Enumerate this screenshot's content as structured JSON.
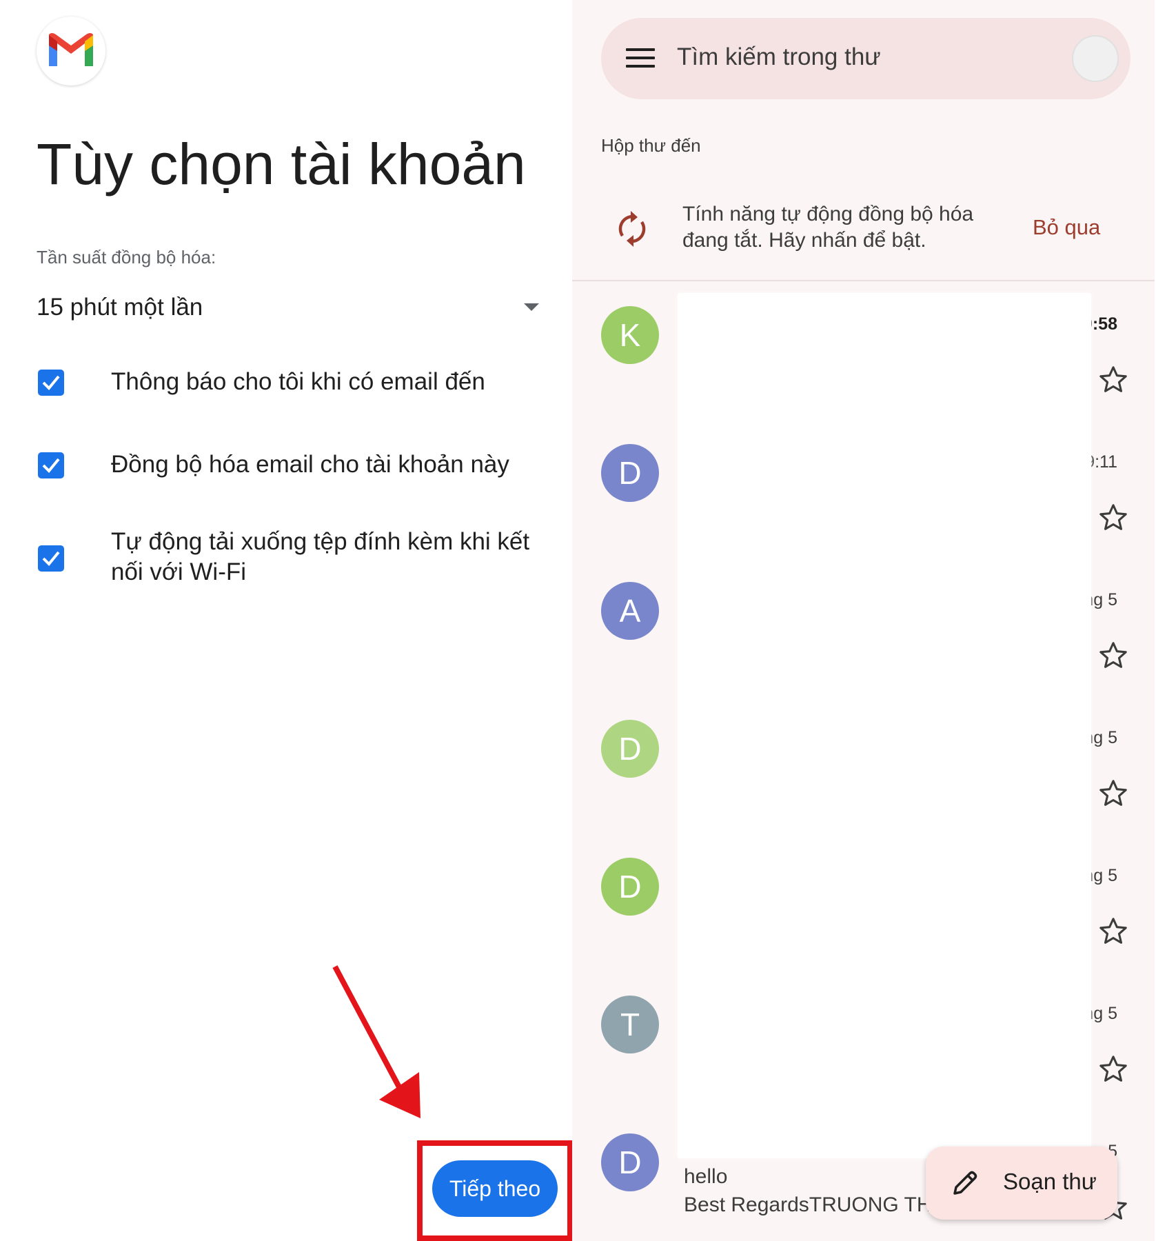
{
  "account_options": {
    "title": "Tùy chọn tài khoản",
    "sync_frequency_label": "Tần suất đồng bộ hóa:",
    "sync_frequency_value": "15 phút một lần",
    "options": [
      {
        "label": "Thông báo cho tôi khi có email đến",
        "checked": true
      },
      {
        "label": "Đồng bộ hóa email cho tài khoản này",
        "checked": true
      },
      {
        "label": "Tự động tải xuống tệp đính kèm khi kết nối với Wi-Fi",
        "checked": true
      }
    ],
    "next_button": "Tiếp theo",
    "accent_color": "#1a73e8",
    "annotation_color": "#e3141a"
  },
  "inbox": {
    "search_placeholder": "Tìm kiếm trong thư",
    "folder_label": "Hộp thư đến",
    "sync_banner_text": "Tính năng tự động đồng bộ hóa đang tắt. Hãy nhấn để bật.",
    "sync_banner_action": "Bỏ qua",
    "emails": [
      {
        "initial": "K",
        "color": "#9ccc65",
        "time": "9:58",
        "unread": true
      },
      {
        "initial": "D",
        "color": "#7986cb",
        "time": "9:11",
        "unread": false
      },
      {
        "initial": "A",
        "color": "#7986cb",
        "time": "thg 5",
        "unread": false
      },
      {
        "initial": "D",
        "color": "#aed581",
        "time": "thg 5",
        "unread": false
      },
      {
        "initial": "D",
        "color": "#9ccc65",
        "time": "thg 5",
        "unread": false
      },
      {
        "initial": "T",
        "color": "#90a4ae",
        "time": "thg 5",
        "unread": false
      },
      {
        "initial": "D",
        "color": "#7986cb",
        "time": "5",
        "unread": false
      }
    ],
    "last_email_subject": "hello",
    "last_email_snippet": "Best RegardsTRUONG THA",
    "compose_label": "Soạn thư"
  }
}
